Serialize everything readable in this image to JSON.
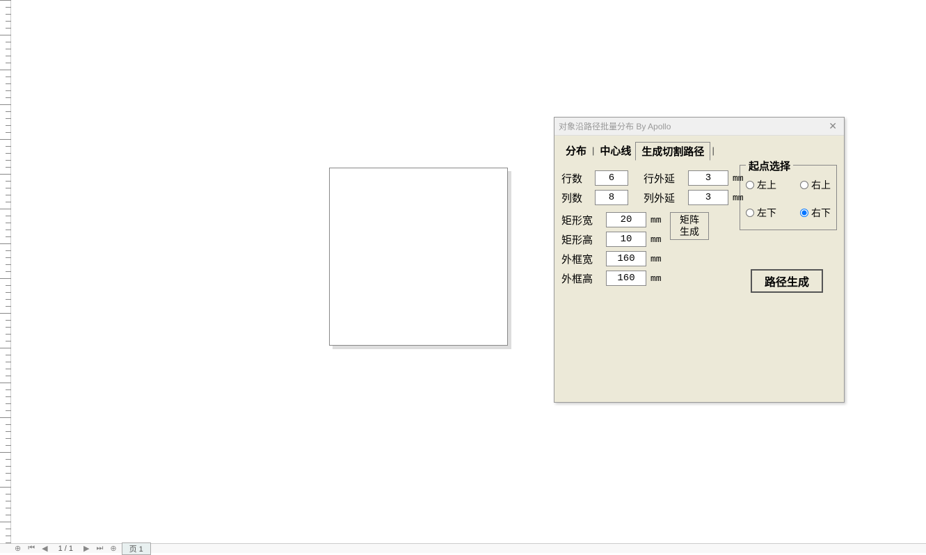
{
  "dialog": {
    "title": "对象沿路径批量分布 By Apollo",
    "tabs": {
      "distribute": "分布",
      "centerline": "中心线",
      "generate_cut_path": "生成切割路径"
    },
    "labels": {
      "rows": "行数",
      "cols": "列数",
      "row_extend": "行外延",
      "col_extend": "列外延",
      "rect_width": "矩形宽",
      "rect_height": "矩形高",
      "frame_width": "外框宽",
      "frame_height": "外框高",
      "unit": "mm"
    },
    "values": {
      "rows": "6",
      "cols": "8",
      "row_extend": "3",
      "col_extend": "3",
      "rect_width": "20",
      "rect_height": "10",
      "frame_width": "160",
      "frame_height": "160"
    },
    "start_point": {
      "legend": "起点选择",
      "top_left": "左上",
      "top_right": "右上",
      "bottom_left": "左下",
      "bottom_right": "右下",
      "selected": "bottom_right"
    },
    "buttons": {
      "matrix_generate": "矩阵\n生成",
      "path_generate": "路径生成"
    }
  },
  "statusbar": {
    "page_indicator": "1 / 1",
    "page_tab": "页 1"
  }
}
